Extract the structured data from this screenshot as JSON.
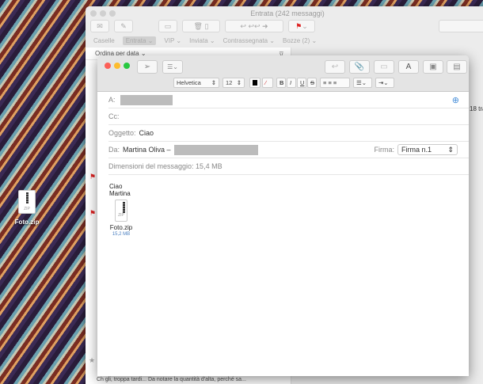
{
  "desktop": {
    "file_label": "Foto.zip",
    "file_ext": "ZIP"
  },
  "mail": {
    "title": "Entrata (242 messaggi)",
    "favorites": [
      "Caselle",
      "Entrata ⌄",
      "VIP ⌄",
      "Inviata ⌄",
      "Contrassegnata ⌄",
      "Bozze (2) ⌄"
    ],
    "sort_label": "Ordina per data ⌄",
    "peek_text": "18 tra",
    "bottom_text": "Ch gli, troppa tardi... Da notare la quantità d'alta, perché sa..."
  },
  "compose": {
    "font": "Helvetica",
    "size": "12",
    "format_buttons": [
      "B",
      "I",
      "U",
      "S"
    ],
    "to_label": "A:",
    "cc_label": "Cc:",
    "subject_label": "Oggetto:",
    "subject": "Ciao",
    "from_label": "Da:",
    "from_name": "Martina Oliva –",
    "signature_label": "Firma:",
    "signature": "Firma n.1",
    "size_label": "Dimensioni del messaggio: 15,4 MB",
    "body_lines": [
      "Ciao",
      "Martina"
    ],
    "attachment": {
      "name": "Foto.zip",
      "size": "15,2 MB",
      "ext": "ZIP"
    }
  }
}
